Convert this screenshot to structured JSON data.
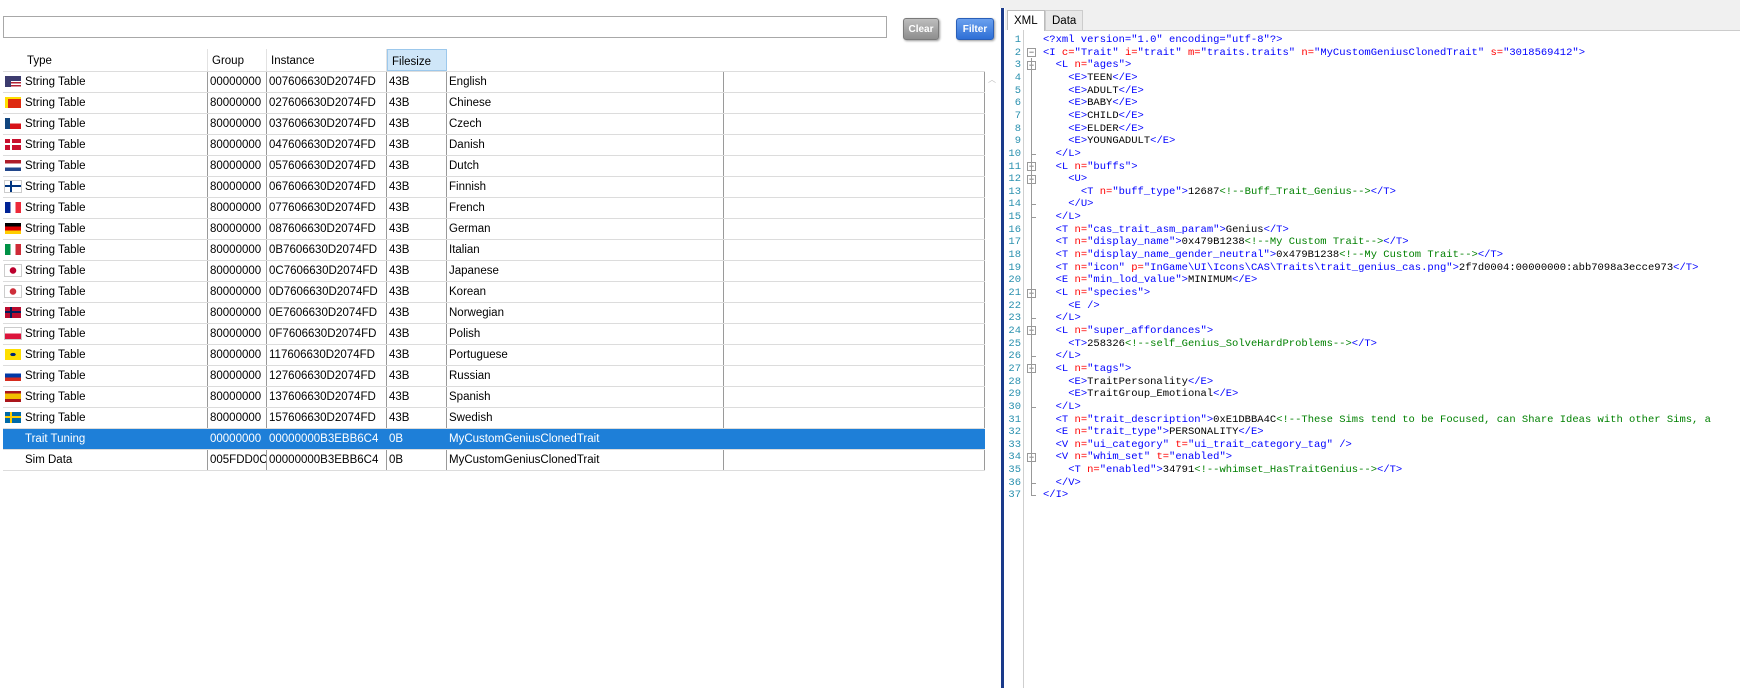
{
  "toolbar": {
    "search_value": "",
    "clear_label": "Clear",
    "filter_label": "Filter"
  },
  "table": {
    "columns": [
      "Type",
      "Group",
      "Instance",
      "Filesize"
    ],
    "rows": [
      {
        "flag": "us",
        "type": "String Table",
        "group": "00000000",
        "instance": "007606630D2074FD",
        "size": "43B",
        "name": "English"
      },
      {
        "flag": "cn",
        "type": "String Table",
        "group": "80000000",
        "instance": "027606630D2074FD",
        "size": "43B",
        "name": "Chinese"
      },
      {
        "flag": "cz",
        "type": "String Table",
        "group": "80000000",
        "instance": "037606630D2074FD",
        "size": "43B",
        "name": "Czech"
      },
      {
        "flag": "dk",
        "type": "String Table",
        "group": "80000000",
        "instance": "047606630D2074FD",
        "size": "43B",
        "name": "Danish"
      },
      {
        "flag": "nl",
        "type": "String Table",
        "group": "80000000",
        "instance": "057606630D2074FD",
        "size": "43B",
        "name": "Dutch"
      },
      {
        "flag": "fi",
        "type": "String Table",
        "group": "80000000",
        "instance": "067606630D2074FD",
        "size": "43B",
        "name": "Finnish"
      },
      {
        "flag": "fr",
        "type": "String Table",
        "group": "80000000",
        "instance": "077606630D2074FD",
        "size": "43B",
        "name": "French"
      },
      {
        "flag": "de",
        "type": "String Table",
        "group": "80000000",
        "instance": "087606630D2074FD",
        "size": "43B",
        "name": "German"
      },
      {
        "flag": "it",
        "type": "String Table",
        "group": "80000000",
        "instance": "0B7606630D2074FD",
        "size": "43B",
        "name": "Italian"
      },
      {
        "flag": "jp",
        "type": "String Table",
        "group": "80000000",
        "instance": "0C7606630D2074FD",
        "size": "43B",
        "name": "Japanese"
      },
      {
        "flag": "kr",
        "type": "String Table",
        "group": "80000000",
        "instance": "0D7606630D2074FD",
        "size": "43B",
        "name": "Korean"
      },
      {
        "flag": "no",
        "type": "String Table",
        "group": "80000000",
        "instance": "0E7606630D2074FD",
        "size": "43B",
        "name": "Norwegian"
      },
      {
        "flag": "pl",
        "type": "String Table",
        "group": "80000000",
        "instance": "0F7606630D2074FD",
        "size": "43B",
        "name": "Polish"
      },
      {
        "flag": "br",
        "type": "String Table",
        "group": "80000000",
        "instance": "117606630D2074FD",
        "size": "43B",
        "name": "Portuguese"
      },
      {
        "flag": "ru",
        "type": "String Table",
        "group": "80000000",
        "instance": "127606630D2074FD",
        "size": "43B",
        "name": "Russian"
      },
      {
        "flag": "es",
        "type": "String Table",
        "group": "80000000",
        "instance": "137606630D2074FD",
        "size": "43B",
        "name": "Spanish"
      },
      {
        "flag": "se",
        "type": "String Table",
        "group": "80000000",
        "instance": "157606630D2074FD",
        "size": "43B",
        "name": "Swedish"
      },
      {
        "flag": "",
        "type": "Trait Tuning",
        "group": "00000000",
        "instance": "00000000B3EBB6C4",
        "size": "0B",
        "name": "MyCustomGeniusClonedTrait",
        "selected": true
      },
      {
        "flag": "",
        "type": "Sim Data",
        "group": "005FDD0C",
        "instance": "00000000B3EBB6C4",
        "size": "0B",
        "name": "MyCustomGeniusClonedTrait"
      }
    ]
  },
  "editor": {
    "tabs": [
      "XML",
      "Data"
    ],
    "active_tab": "XML",
    "lines": [
      [
        [
          "tag",
          "<?xml version=\"1.0\" encoding=\"utf-8\"?>"
        ]
      ],
      [
        [
          "tag",
          "<I "
        ],
        [
          "attr",
          "c="
        ],
        [
          "val",
          "\"Trait\" "
        ],
        [
          "attr",
          "i="
        ],
        [
          "val",
          "\"trait\" "
        ],
        [
          "attr",
          "m="
        ],
        [
          "val",
          "\"traits.traits\" "
        ],
        [
          "attr",
          "n="
        ],
        [
          "val",
          "\"MyCustomGeniusClonedTrait\" "
        ],
        [
          "attr",
          "s="
        ],
        [
          "val",
          "\"3018569412\""
        ],
        [
          "tag",
          ">"
        ]
      ],
      [
        [
          "txt",
          "  "
        ],
        [
          "tag",
          "<L "
        ],
        [
          "attr",
          "n="
        ],
        [
          "val",
          "\"ages\""
        ],
        [
          "tag",
          ">"
        ]
      ],
      [
        [
          "txt",
          "    "
        ],
        [
          "tag",
          "<E>"
        ],
        [
          "txt",
          "TEEN"
        ],
        [
          "tag",
          "</E>"
        ]
      ],
      [
        [
          "txt",
          "    "
        ],
        [
          "tag",
          "<E>"
        ],
        [
          "txt",
          "ADULT"
        ],
        [
          "tag",
          "</E>"
        ]
      ],
      [
        [
          "txt",
          "    "
        ],
        [
          "tag",
          "<E>"
        ],
        [
          "txt",
          "BABY"
        ],
        [
          "tag",
          "</E>"
        ]
      ],
      [
        [
          "txt",
          "    "
        ],
        [
          "tag",
          "<E>"
        ],
        [
          "txt",
          "CHILD"
        ],
        [
          "tag",
          "</E>"
        ]
      ],
      [
        [
          "txt",
          "    "
        ],
        [
          "tag",
          "<E>"
        ],
        [
          "txt",
          "ELDER"
        ],
        [
          "tag",
          "</E>"
        ]
      ],
      [
        [
          "txt",
          "    "
        ],
        [
          "tag",
          "<E>"
        ],
        [
          "txt",
          "YOUNGADULT"
        ],
        [
          "tag",
          "</E>"
        ]
      ],
      [
        [
          "txt",
          "  "
        ],
        [
          "tag",
          "</L>"
        ]
      ],
      [
        [
          "txt",
          "  "
        ],
        [
          "tag",
          "<L "
        ],
        [
          "attr",
          "n="
        ],
        [
          "val",
          "\"buffs\""
        ],
        [
          "tag",
          ">"
        ]
      ],
      [
        [
          "txt",
          "    "
        ],
        [
          "tag",
          "<U>"
        ]
      ],
      [
        [
          "txt",
          "      "
        ],
        [
          "tag",
          "<T "
        ],
        [
          "attr",
          "n="
        ],
        [
          "val",
          "\"buff_type\""
        ],
        [
          "tag",
          ">"
        ],
        [
          "txt",
          "12687"
        ],
        [
          "com",
          "<!--Buff_Trait_Genius-->"
        ],
        [
          "tag",
          "</T>"
        ]
      ],
      [
        [
          "txt",
          "    "
        ],
        [
          "tag",
          "</U>"
        ]
      ],
      [
        [
          "txt",
          "  "
        ],
        [
          "tag",
          "</L>"
        ]
      ],
      [
        [
          "txt",
          "  "
        ],
        [
          "tag",
          "<T "
        ],
        [
          "attr",
          "n="
        ],
        [
          "val",
          "\"cas_trait_asm_param\""
        ],
        [
          "tag",
          ">"
        ],
        [
          "txt",
          "Genius"
        ],
        [
          "tag",
          "</T>"
        ]
      ],
      [
        [
          "txt",
          "  "
        ],
        [
          "tag",
          "<T "
        ],
        [
          "attr",
          "n="
        ],
        [
          "val",
          "\"display_name\""
        ],
        [
          "tag",
          ">"
        ],
        [
          "txt",
          "0x479B1238"
        ],
        [
          "com",
          "<!--My Custom Trait-->"
        ],
        [
          "tag",
          "</T>"
        ]
      ],
      [
        [
          "txt",
          "  "
        ],
        [
          "tag",
          "<T "
        ],
        [
          "attr",
          "n="
        ],
        [
          "val",
          "\"display_name_gender_neutral\""
        ],
        [
          "tag",
          ">"
        ],
        [
          "txt",
          "0x479B1238"
        ],
        [
          "com",
          "<!--My Custom Trait-->"
        ],
        [
          "tag",
          "</T>"
        ]
      ],
      [
        [
          "txt",
          "  "
        ],
        [
          "tag",
          "<T "
        ],
        [
          "attr",
          "n="
        ],
        [
          "val",
          "\"icon\" "
        ],
        [
          "attr",
          "p="
        ],
        [
          "val",
          "\"InGame\\UI\\Icons\\CAS\\Traits\\trait_genius_cas.png\""
        ],
        [
          "tag",
          ">"
        ],
        [
          "txt",
          "2f7d0004:00000000:abb7098a3ecce973"
        ],
        [
          "tag",
          "</T>"
        ]
      ],
      [
        [
          "txt",
          "  "
        ],
        [
          "tag",
          "<E "
        ],
        [
          "attr",
          "n="
        ],
        [
          "val",
          "\"min_lod_value\""
        ],
        [
          "tag",
          ">"
        ],
        [
          "txt",
          "MINIMUM"
        ],
        [
          "tag",
          "</E>"
        ]
      ],
      [
        [
          "txt",
          "  "
        ],
        [
          "tag",
          "<L "
        ],
        [
          "attr",
          "n="
        ],
        [
          "val",
          "\"species\""
        ],
        [
          "tag",
          ">"
        ]
      ],
      [
        [
          "txt",
          "    "
        ],
        [
          "tag",
          "<E />"
        ]
      ],
      [
        [
          "txt",
          "  "
        ],
        [
          "tag",
          "</L>"
        ]
      ],
      [
        [
          "txt",
          "  "
        ],
        [
          "tag",
          "<L "
        ],
        [
          "attr",
          "n="
        ],
        [
          "val",
          "\"super_affordances\""
        ],
        [
          "tag",
          ">"
        ]
      ],
      [
        [
          "txt",
          "    "
        ],
        [
          "tag",
          "<T>"
        ],
        [
          "txt",
          "258326"
        ],
        [
          "com",
          "<!--self_Genius_SolveHardProblems-->"
        ],
        [
          "tag",
          "</T>"
        ]
      ],
      [
        [
          "txt",
          "  "
        ],
        [
          "tag",
          "</L>"
        ]
      ],
      [
        [
          "txt",
          "  "
        ],
        [
          "tag",
          "<L "
        ],
        [
          "attr",
          "n="
        ],
        [
          "val",
          "\"tags\""
        ],
        [
          "tag",
          ">"
        ]
      ],
      [
        [
          "txt",
          "    "
        ],
        [
          "tag",
          "<E>"
        ],
        [
          "txt",
          "TraitPersonality"
        ],
        [
          "tag",
          "</E>"
        ]
      ],
      [
        [
          "txt",
          "    "
        ],
        [
          "tag",
          "<E>"
        ],
        [
          "txt",
          "TraitGroup_Emotional"
        ],
        [
          "tag",
          "</E>"
        ]
      ],
      [
        [
          "txt",
          "  "
        ],
        [
          "tag",
          "</L>"
        ]
      ],
      [
        [
          "txt",
          "  "
        ],
        [
          "tag",
          "<T "
        ],
        [
          "attr",
          "n="
        ],
        [
          "val",
          "\"trait_description\""
        ],
        [
          "tag",
          ">"
        ],
        [
          "txt",
          "0xE1DBBA4C"
        ],
        [
          "com",
          "<!--These Sims tend to be Focused, can Share Ideas with other Sims, a"
        ]
      ],
      [
        [
          "txt",
          "  "
        ],
        [
          "tag",
          "<E "
        ],
        [
          "attr",
          "n="
        ],
        [
          "val",
          "\"trait_type\""
        ],
        [
          "tag",
          ">"
        ],
        [
          "txt",
          "PERSONALITY"
        ],
        [
          "tag",
          "</E>"
        ]
      ],
      [
        [
          "txt",
          "  "
        ],
        [
          "tag",
          "<V "
        ],
        [
          "attr",
          "n="
        ],
        [
          "val",
          "\"ui_category\" "
        ],
        [
          "attr",
          "t="
        ],
        [
          "val",
          "\"ui_trait_category_tag\" "
        ],
        [
          "tag",
          "/>"
        ]
      ],
      [
        [
          "txt",
          "  "
        ],
        [
          "tag",
          "<V "
        ],
        [
          "attr",
          "n="
        ],
        [
          "val",
          "\"whim_set\" "
        ],
        [
          "attr",
          "t="
        ],
        [
          "val",
          "\"enabled\""
        ],
        [
          "tag",
          ">"
        ]
      ],
      [
        [
          "txt",
          "    "
        ],
        [
          "tag",
          "<T "
        ],
        [
          "attr",
          "n="
        ],
        [
          "val",
          "\"enabled\""
        ],
        [
          "tag",
          ">"
        ],
        [
          "txt",
          "34791"
        ],
        [
          "com",
          "<!--whimset_HasTraitGenius-->"
        ],
        [
          "tag",
          "</T>"
        ]
      ],
      [
        [
          "txt",
          "  "
        ],
        [
          "tag",
          "</V>"
        ]
      ],
      [
        [
          "tag",
          "</I>"
        ]
      ]
    ]
  }
}
